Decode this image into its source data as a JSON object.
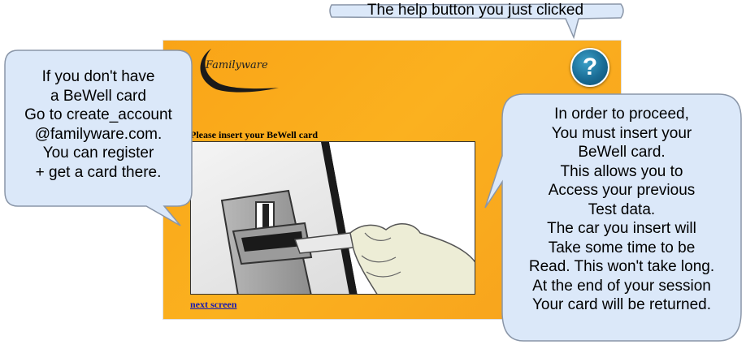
{
  "callouts": {
    "help_caption": "The help button you just clicked",
    "left_note": [
      "If you don't have",
      "a BeWell card",
      "Go to create_account",
      "@familyware.com.",
      "You can register",
      "+ get a card there."
    ],
    "right_note": [
      "In order to proceed,",
      "You must insert your",
      "BeWell card.",
      "This allows you to",
      "Access your previous",
      "Test data.",
      "The car you insert will",
      "Take some time to be",
      "Read. This won't take long.",
      "At the end of your session",
      "Your card will be returned."
    ]
  },
  "app": {
    "logo_text": "Familyware",
    "help_icon": "?",
    "prompt": "Please insert your BeWell card",
    "next_link": "next screen"
  },
  "colors": {
    "panel": "#fbad1e",
    "bubble_fill": "#dbe8f9",
    "bubble_stroke": "#8a96a8",
    "help_button": "#1a6c95"
  }
}
